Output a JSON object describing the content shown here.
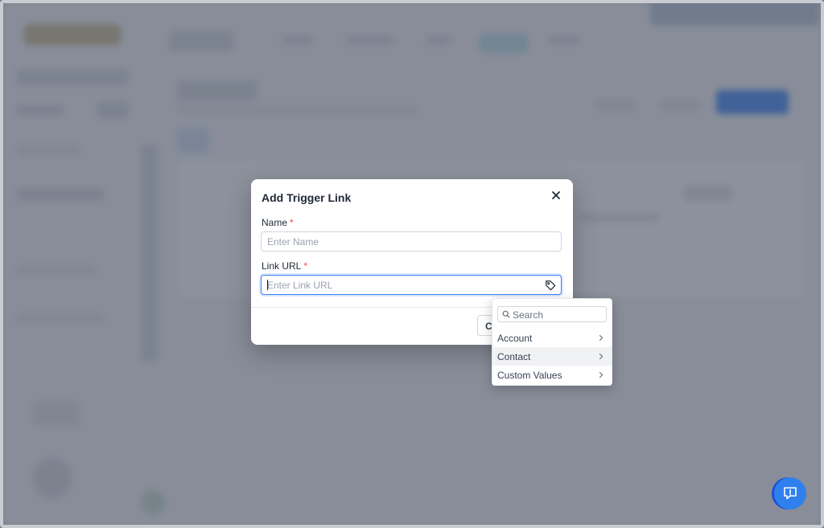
{
  "modal": {
    "title": "Add Trigger Link",
    "name_label": "Name",
    "name_placeholder": "Enter Name",
    "url_label": "Link URL",
    "url_placeholder": "Enter Link URL",
    "required_mark": "*",
    "cancel_label": "C"
  },
  "dropdown": {
    "search_placeholder": "Search",
    "items": [
      {
        "label": "Account"
      },
      {
        "label": "Contact"
      },
      {
        "label": "Custom Values"
      }
    ]
  },
  "icons": {
    "close": "close-icon",
    "tag": "tag-icon",
    "search": "search-icon",
    "chevron": "chevron-right-icon",
    "help": "chat-alert-icon"
  },
  "colors": {
    "accent": "#3b82f6",
    "required": "#ef4444",
    "help_button": "#2f80ed"
  }
}
